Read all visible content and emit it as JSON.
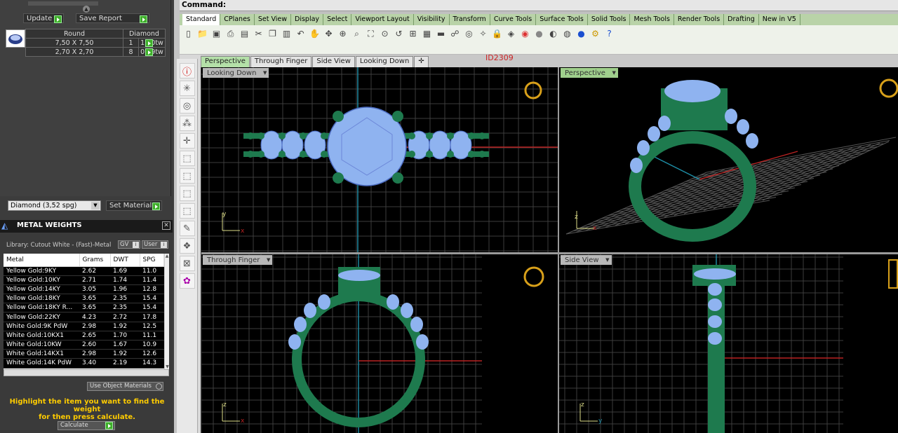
{
  "left_panel": {
    "update_label": "Update",
    "save_report_label": "Save Report",
    "stone_table": {
      "headers": [
        "Round",
        "Diamond"
      ],
      "rows": [
        [
          "7,50 X 7,50",
          "1",
          "1,60tw"
        ],
        [
          "2,70 X 2,70",
          "8",
          "0,59tw"
        ]
      ]
    },
    "material_select_value": "Diamond     (3,52 spg)",
    "set_material_label": "Set Material",
    "metal_weights_title": "METAL WEIGHTS",
    "library_text": "Library: Cutout White - (Fast)-Metal",
    "gv_label": "GV",
    "user_label": "User",
    "weights_table": {
      "headers": [
        "Metal",
        "Grams",
        "DWT",
        "SPG"
      ],
      "rows": [
        [
          "Yellow Gold:9KY",
          "2.62",
          "1.69",
          "11.0"
        ],
        [
          "Yellow Gold:10KY",
          "2.71",
          "1.74",
          "11.4"
        ],
        [
          "Yellow Gold:14KY",
          "3.05",
          "1.96",
          "12.8"
        ],
        [
          "Yellow Gold:18KY",
          "3.65",
          "2.35",
          "15.4"
        ],
        [
          "Yellow Gold:18KY R...",
          "3.65",
          "2.35",
          "15.4"
        ],
        [
          "Yellow Gold:22KY",
          "4.23",
          "2.72",
          "17.8"
        ],
        [
          "White Gold:9K PdW",
          "2.98",
          "1.92",
          "12.5"
        ],
        [
          "White Gold:10KX1",
          "2.65",
          "1.70",
          "11.1"
        ],
        [
          "White Gold:10KW",
          "2.60",
          "1.67",
          "10.9"
        ],
        [
          "White Gold:14KX1",
          "2.98",
          "1.92",
          "12.6"
        ],
        [
          "White Gold:14K PdW",
          "3.40",
          "2.19",
          "14.3"
        ]
      ]
    },
    "use_object_materials_label": "Use Object Materials",
    "hint_line1": "Highlight the item you want to find the weight",
    "hint_line2": "for then press calculate.",
    "calculate_label": "Calculate"
  },
  "command_label": "Command:",
  "toolbar_tabs": [
    "Standard",
    "CPlanes",
    "Set View",
    "Display",
    "Select",
    "Viewport Layout",
    "Visibility",
    "Transform",
    "Curve Tools",
    "Surface Tools",
    "Solid Tools",
    "Mesh Tools",
    "Render Tools",
    "Drafting",
    "New in V5"
  ],
  "toolbar_icons": [
    "new-icon",
    "open-icon",
    "save-icon",
    "print-icon",
    "import-icon",
    "cut-icon",
    "copy-icon",
    "paste-icon",
    "undo-icon",
    "pan-icon",
    "rotate-icon",
    "zoom-icon",
    "zoom-window-icon",
    "zoom-extents-icon",
    "zoom-selected-icon",
    "undo-view-icon",
    "four-view-icon",
    "grid-icon",
    "cplane-icon",
    "properties-icon",
    "osnap-icon",
    "light-icon",
    "lock-icon",
    "layer-icon",
    "color-icon",
    "render-icon",
    "shade-icon",
    "ghost-icon",
    "material-icon",
    "settings-icon",
    "help-icon"
  ],
  "viewport_tabs": [
    "Perspective",
    "Through Finger",
    "Side View",
    "Looking Down"
  ],
  "id_label": "ID2309",
  "viewports": {
    "looking_down": "Looking Down",
    "perspective": "Perspective",
    "through_finger": "Through Finger",
    "side_view": "Side View"
  },
  "axis_labels": {
    "x": "x",
    "y": "y",
    "z": "z"
  },
  "colors": {
    "metal": "#1e7a4e",
    "stone": "#8fb3f0",
    "accent_green": "#3fae2a",
    "hint_yellow": "#ffcc00",
    "id_red": "#cc2222"
  }
}
